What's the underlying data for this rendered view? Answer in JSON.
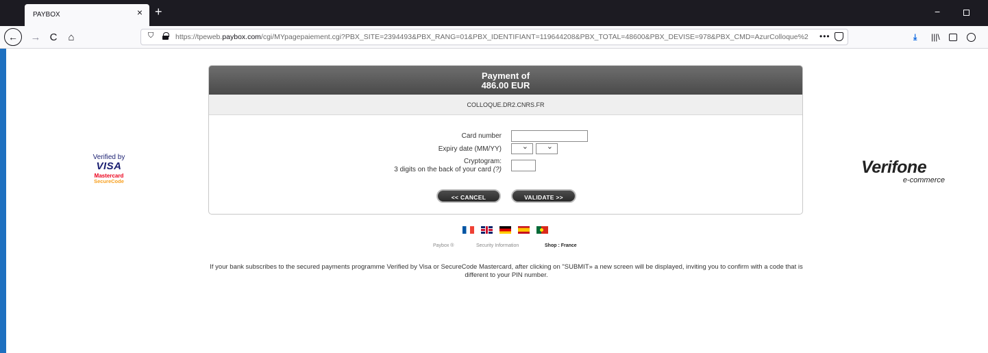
{
  "browser": {
    "tab_title": "PAYBOX",
    "tab_close": "×",
    "new_tab": "+",
    "win_min": "−",
    "back": "←",
    "forward": "→",
    "reload": "C",
    "home": "⌂",
    "shield": "⛉",
    "url_prefix": "https://tpeweb.",
    "url_domain": "paybox.com",
    "url_rest": "/cgi/MYpagepaiement.cgi?PBX_SITE=2394493&PBX_RANG=01&PBX_IDENTIFIANT=119644208&PBX_TOTAL=48600&PBX_DEVISE=978&PBX_CMD=AzurColloque%2",
    "url_more": "•••",
    "download": "⤓",
    "library": "|||\\"
  },
  "logos": {
    "vbv_line1": "Verified by",
    "vbv_line2": "VISA",
    "mc_line1": "Mastercard",
    "mc_line2": "SecureCode",
    "verifone": "Verifone",
    "verifone_sub": "e-commerce"
  },
  "payment": {
    "heading": "Payment of",
    "amount": "486.00 EUR",
    "merchant": "COLLOQUE.DR2.CNRS.FR"
  },
  "form": {
    "card_number_label": "Card number",
    "card_number_value": "",
    "expiry_label": "Expiry date (MM/YY)",
    "expiry_month": "",
    "expiry_year": "",
    "cvv_label_1": "Cryptogram:",
    "cvv_label_2": "3 digits on the back of your card",
    "cvv_help": "(?)",
    "cvv_value": "",
    "cancel_label": "<< CANCEL",
    "validate_label": "VALIDATE >>"
  },
  "footer": {
    "paybox": "Paybox ®",
    "security": "Security Information",
    "shop": "Shop : France",
    "notice": "If your bank subscribes to the secured payments programme Verified by Visa or SecureCode Mastercard, after clicking on \"SUBMIT» a new screen will be displayed, inviting you to confirm with a code that is different to your PIN number."
  }
}
